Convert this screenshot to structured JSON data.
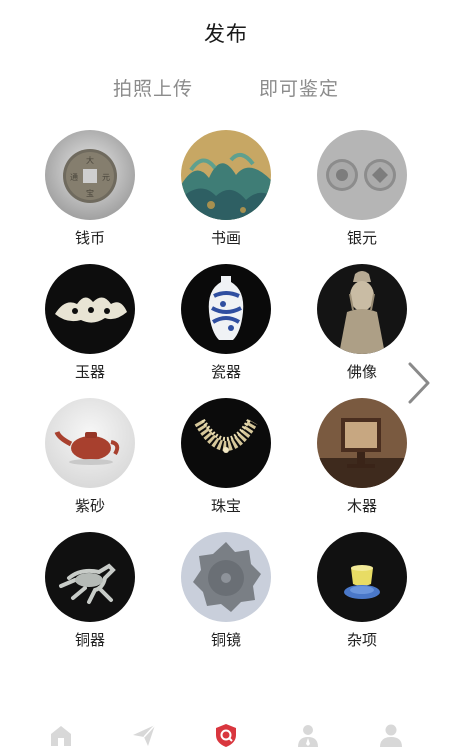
{
  "header": {
    "title": "发布"
  },
  "subtitle": {
    "left": "拍照上传",
    "right": "即可鉴定"
  },
  "categories": [
    {
      "label": "钱币",
      "icon": "coin-thumbnail"
    },
    {
      "label": "书画",
      "icon": "painting-thumbnail"
    },
    {
      "label": "银元",
      "icon": "silver-dollar-thumbnail"
    },
    {
      "label": "玉器",
      "icon": "jade-thumbnail"
    },
    {
      "label": "瓷器",
      "icon": "porcelain-thumbnail"
    },
    {
      "label": "佛像",
      "icon": "buddha-thumbnail"
    },
    {
      "label": "紫砂",
      "icon": "teapot-thumbnail"
    },
    {
      "label": "珠宝",
      "icon": "jewelry-thumbnail"
    },
    {
      "label": "木器",
      "icon": "wood-thumbnail"
    },
    {
      "label": "铜器",
      "icon": "bronze-thumbnail"
    },
    {
      "label": "铜镜",
      "icon": "bronze-mirror-thumbnail"
    },
    {
      "label": "杂项",
      "icon": "misc-thumbnail"
    }
  ],
  "tabbar": {
    "items": [
      {
        "icon": "home-icon",
        "active": false
      },
      {
        "icon": "send-icon",
        "active": false
      },
      {
        "icon": "shield-icon",
        "active": true
      },
      {
        "icon": "expert-icon",
        "active": false
      },
      {
        "icon": "profile-icon",
        "active": false
      }
    ],
    "colors": {
      "active": "#d9363e",
      "inactive": "#d8d8d8"
    }
  }
}
